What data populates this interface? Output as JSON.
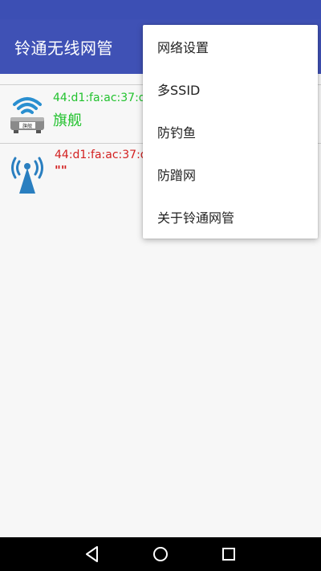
{
  "app": {
    "title": "铃通无线网管"
  },
  "colors": {
    "app_bar": "#3f51b5",
    "online": "#22c22e",
    "offline": "#d32020"
  },
  "devices": [
    {
      "mac": "44:d1:fa:ac:37:d",
      "name": "旗舰",
      "icon": "router-wifi-icon",
      "icon_badge": "旗舰",
      "status": "online"
    },
    {
      "mac": "44:d1:fa:ac:37:d",
      "name": "\"\"",
      "icon": "antenna-wifi-icon",
      "status": "offline"
    }
  ],
  "menu": {
    "items": [
      {
        "label": "网络设置"
      },
      {
        "label": "多SSID"
      },
      {
        "label": "防钓鱼"
      },
      {
        "label": "防蹭网"
      },
      {
        "label": "关于铃通网管"
      }
    ]
  },
  "nav": {
    "back": "back-triangle-icon",
    "home": "home-circle-icon",
    "recents": "recents-square-icon"
  }
}
